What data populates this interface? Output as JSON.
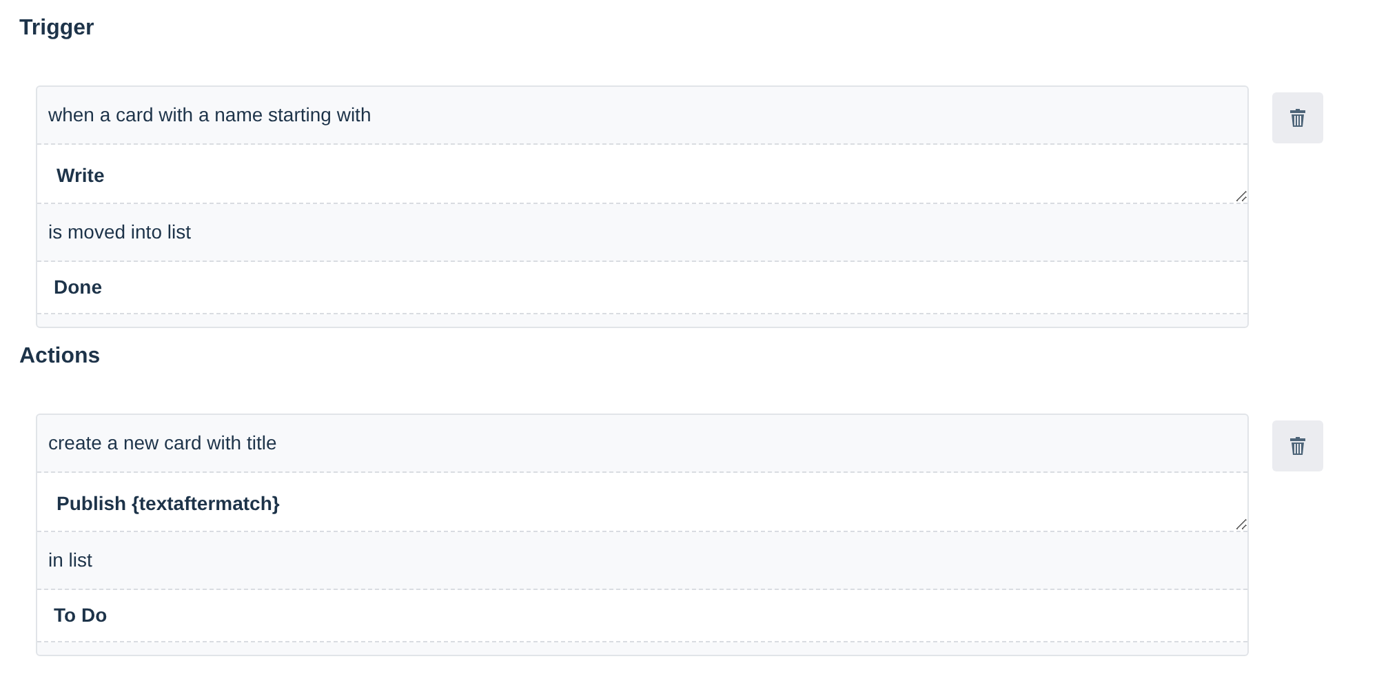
{
  "sections": [
    {
      "heading": "Trigger",
      "parts": [
        {
          "kind": "label",
          "text": "when a card with a name starting with"
        },
        {
          "kind": "textarea",
          "value": "Write"
        },
        {
          "kind": "label",
          "text": "is moved into list"
        },
        {
          "kind": "select",
          "value": "Done"
        }
      ]
    },
    {
      "heading": "Actions",
      "parts": [
        {
          "kind": "label",
          "text": "create a new card with title"
        },
        {
          "kind": "textarea",
          "value": "Publish {textaftermatch}"
        },
        {
          "kind": "label",
          "text": "in list"
        },
        {
          "kind": "select",
          "value": "To Do"
        }
      ]
    }
  ]
}
